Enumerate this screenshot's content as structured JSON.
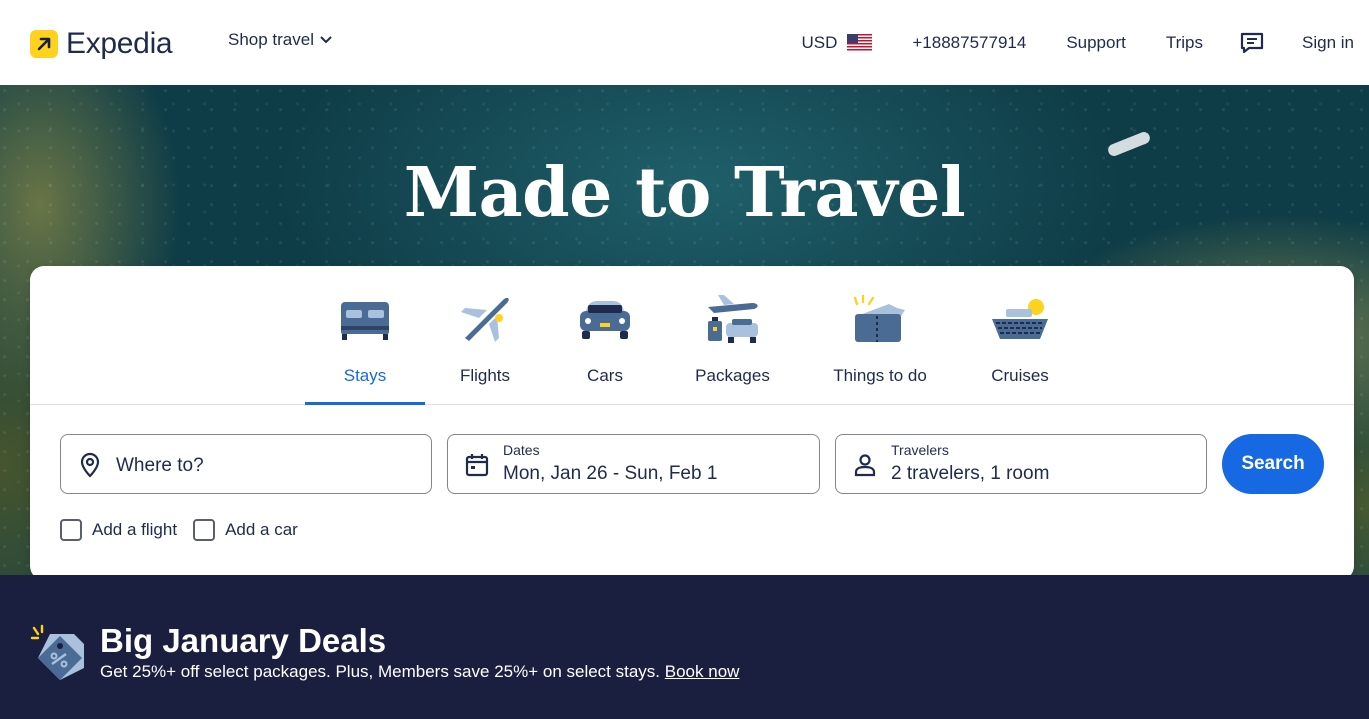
{
  "header": {
    "logo_text": "Expedia",
    "shop_travel": "Shop travel",
    "currency": "USD",
    "phone": "+18887577914",
    "support": "Support",
    "trips": "Trips",
    "sign_in": "Sign in"
  },
  "hero": {
    "title": "Made to Travel"
  },
  "tabs": [
    {
      "label": "Stays",
      "icon": "bed-icon",
      "active": true
    },
    {
      "label": "Flights",
      "icon": "airplane-icon"
    },
    {
      "label": "Cars",
      "icon": "car-icon"
    },
    {
      "label": "Packages",
      "icon": "packages-icon"
    },
    {
      "label": "Things to do",
      "icon": "ticket-icon"
    },
    {
      "label": "Cruises",
      "icon": "cruise-ship-icon"
    }
  ],
  "search": {
    "destination_placeholder": "Where to?",
    "dates_label": "Dates",
    "dates_value": "Mon, Jan 26 - Sun, Feb 1",
    "travelers_label": "Travelers",
    "travelers_value": "2 travelers, 1 room",
    "search_button": "Search",
    "add_flight": "Add a flight",
    "add_car": "Add a car"
  },
  "deals": {
    "title": "Big January Deals",
    "text": "Get 25%+ off select packages. Plus, Members save 25%+ on select stays.",
    "link": "Book now"
  },
  "colors": {
    "brand_yellow": "#ffd21f",
    "primary_blue": "#1668e3",
    "navy": "#1f2b4d",
    "banner_bg": "#1b1f3f"
  }
}
